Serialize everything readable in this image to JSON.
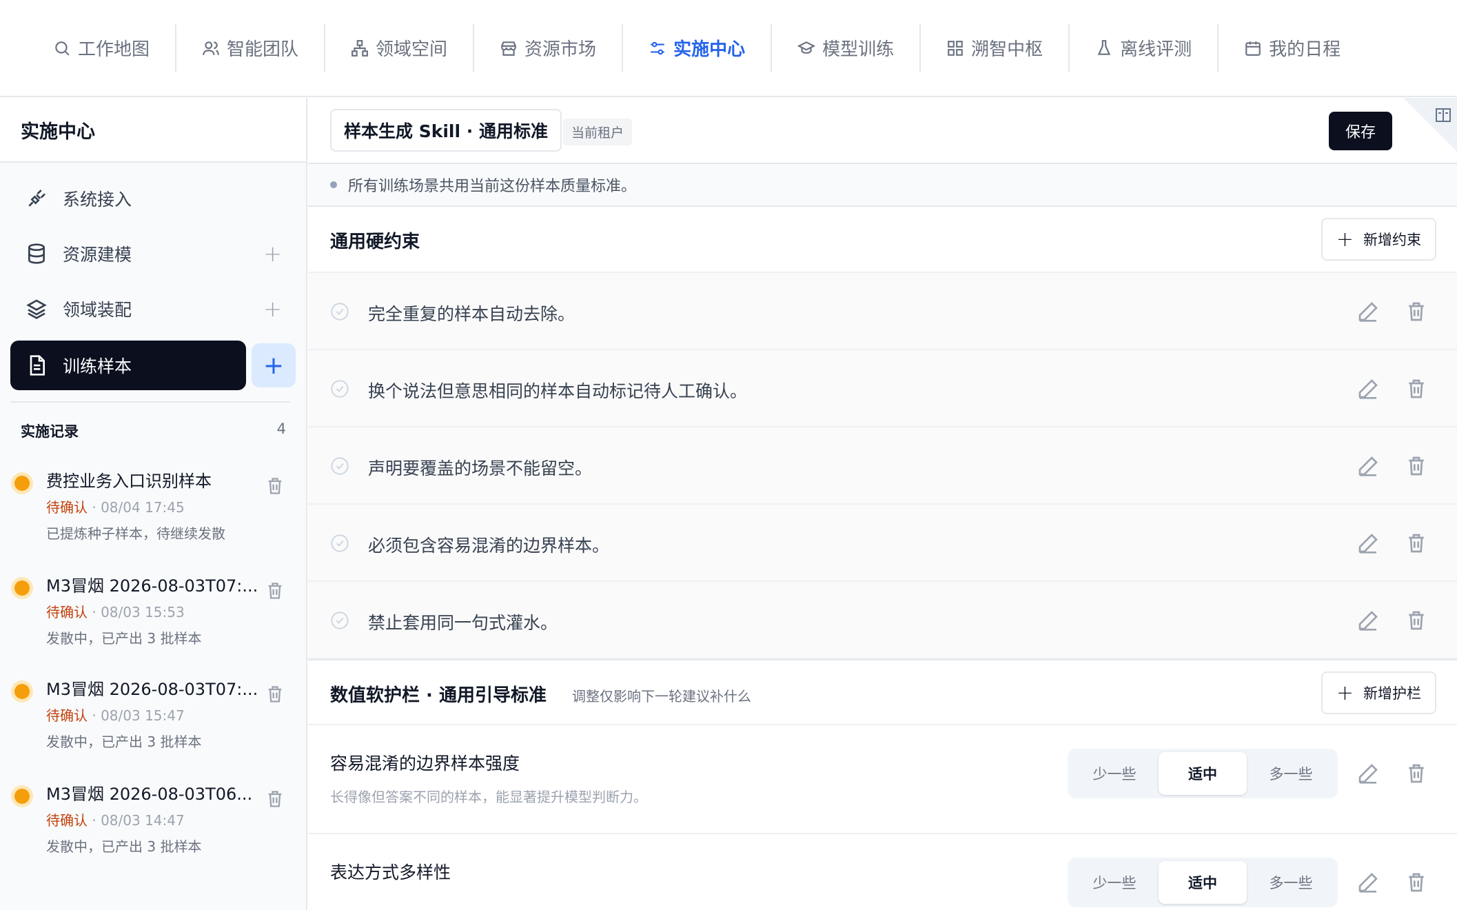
{
  "topnav": {
    "items": [
      {
        "label": "工作地图",
        "icon": "search-icon"
      },
      {
        "label": "智能团队",
        "icon": "users-icon"
      },
      {
        "label": "领域空间",
        "icon": "hierarchy-icon"
      },
      {
        "label": "资源市场",
        "icon": "store-icon"
      },
      {
        "label": "实施中心",
        "icon": "sliders-icon",
        "active": true
      },
      {
        "label": "模型训练",
        "icon": "graduation-cap-icon"
      },
      {
        "label": "溯智中枢",
        "icon": "grid-icon"
      },
      {
        "label": "离线评测",
        "icon": "flask-icon"
      },
      {
        "label": "我的日程",
        "icon": "calendar-icon"
      }
    ],
    "active_color": "#2563eb"
  },
  "sidebar": {
    "title": "实施中心",
    "items": [
      {
        "label": "系统接入",
        "icon": "plug-icon"
      },
      {
        "label": "资源建模",
        "icon": "database-icon",
        "plus": "+"
      },
      {
        "label": "领域装配",
        "icon": "layers-icon",
        "plus": "+"
      },
      {
        "label": "训练样本",
        "icon": "document-icon",
        "active": true
      }
    ],
    "add_label": "+",
    "records": {
      "title": "实施记录",
      "count": "4",
      "items": [
        {
          "name": "费控业务入口识别样本",
          "status": "待确认",
          "time": "08/04 17:45",
          "desc": "已提炼种子样本，待继续发散"
        },
        {
          "name": "M3冒烟 2026-08-03T07:...",
          "status": "待确认",
          "time": "08/03 15:53",
          "desc": "发散中，已产出 3 批样本"
        },
        {
          "name": "M3冒烟 2026-08-03T07:...",
          "status": "待确认",
          "time": "08/03 15:47",
          "desc": "发散中，已产出 3 批样本"
        },
        {
          "name": "M3冒烟 2026-08-03T06...",
          "status": "待确认",
          "time": "08/03 14:47",
          "desc": "发散中，已产出 3 批样本"
        }
      ],
      "status_color": "#c2410c",
      "dot_color": "#f59e0b"
    }
  },
  "main": {
    "skill_title": "样本生成 Skill · 通用标准",
    "tenant_badge": "当前租户",
    "save_label": "保存",
    "notice": "所有训练场景共用当前这份样本质量标准。",
    "hard": {
      "title": "通用硬约束",
      "add_label": "新增约束",
      "rules": [
        "完全重复的样本自动去除。",
        "换个说法但意思相同的样本自动标记待人工确认。",
        "声明要覆盖的场景不能留空。",
        "必须包含容易混淆的边界样本。",
        "禁止套用同一句式灌水。"
      ]
    },
    "soft": {
      "title": "数值软护栏 · 通用引导标准",
      "subtitle": "调整仅影响下一轮建议补什么",
      "add_label": "新增护栏",
      "options": [
        "少一些",
        "适中",
        "多一些"
      ],
      "guards": [
        {
          "title": "容易混淆的边界样本强度",
          "desc": "长得像但答案不同的样本，能显著提升模型判断力。",
          "selected": "适中"
        },
        {
          "title": "表达方式多样性",
          "desc": "",
          "selected": "适中"
        }
      ]
    }
  }
}
